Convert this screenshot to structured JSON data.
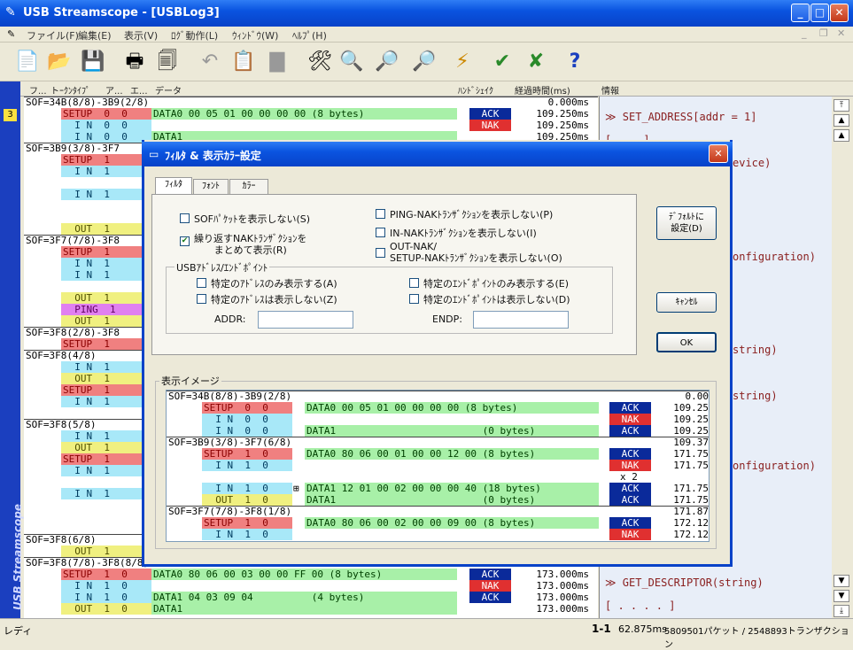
{
  "app": {
    "title": "USB Streamscope - [USBLog3]"
  },
  "menu": {
    "items": [
      "ファイル(F)",
      "編集(E)",
      "表示(V)",
      "ﾛｸﾞ動作(L)",
      "ｳｨﾝﾄﾞｳ(W)",
      "ﾍﾙﾌﾟ(H)"
    ]
  },
  "columns": {
    "c1": "フ...",
    "c2": "トｰｸﾝﾀｲﾌﾟ",
    "c3": "ア...",
    "c4": "エ...",
    "c5": "データ",
    "c6": "ﾊﾝﾄﾞｼｪｲｸ",
    "c7": "経過時間(ms)",
    "c8": "情報"
  },
  "sidebar": {
    "label": "USB Streamscope",
    "marker": "3"
  },
  "list": {
    "rows": [
      {
        "sof": "SOF=34B(8/8)-3B9(2/8)",
        "t": "0.000ms"
      },
      {
        "tok": "SETUP  0  0",
        "data": "DATA0 00 05 01 00 00 00 00 (8 bytes)",
        "hs": "ACK",
        "t": "109.250ms"
      },
      {
        "tok": "  I N  0  0",
        "hs": "NAK",
        "t": "109.250ms"
      },
      {
        "tok": "  I N  0  0",
        "data": "DATA1",
        "t": "109.250ms"
      },
      {
        "sof": "SOF=3B9(3/8)-3F7"
      },
      {
        "tok": "SETUP  1",
        "cls": "setup"
      },
      {
        "tok": "  I N  1",
        "cls": "in"
      },
      {
        "tok": "  I N  1",
        "cls": "in"
      },
      {
        "tok": "  OUT  1",
        "cls": "out"
      },
      {
        "sof": "SOF=3F7(7/8)-3F8"
      },
      {
        "tok": "SETUP  1",
        "cls": "setup"
      },
      {
        "tok": "  I N  1",
        "cls": "in"
      },
      {
        "tok": "  I N  1",
        "cls": "in"
      },
      {
        "tok": "  OUT  1",
        "cls": "out"
      },
      {
        "tok": "  PING  1",
        "cls": "ping"
      },
      {
        "tok": "  OUT  1",
        "cls": "out"
      },
      {
        "sof": "SOF=3F8(2/8)-3F8"
      },
      {
        "tok": "SETUP  1",
        "cls": "setup"
      },
      {
        "sof": "SOF=3F8(4/8)"
      },
      {
        "tok": "  I N  1",
        "cls": "in"
      },
      {
        "tok": "  OUT  1",
        "cls": "out"
      },
      {
        "tok": "SETUP  1",
        "cls": "setup"
      },
      {
        "tok": "  I N  1",
        "cls": "in"
      },
      {
        "sof": "SOF=3F8(5/8)"
      },
      {
        "tok": "  I N  1",
        "cls": "in"
      },
      {
        "tok": "  OUT  1",
        "cls": "out"
      },
      {
        "tok": "SETUP  1",
        "cls": "setup"
      },
      {
        "tok": "  I N  1",
        "cls": "in"
      },
      {
        "tok": "  I N  1",
        "cls": "in"
      },
      {
        "sof": "SOF=3F8(6/8)"
      },
      {
        "tok": "  OUT  1",
        "cls": "out"
      },
      {
        "sof": "SOF=3F8(7/8)-3F8(8/8)",
        "t": "172.875ms"
      },
      {
        "tok": "SETUP  1  0",
        "data": "DATA0 80 06 00 03 00 00 FF 00 (8 bytes)",
        "hs": "ACK",
        "t": "173.000ms"
      },
      {
        "tok": "  I N  1  0",
        "hs": "NAK",
        "t": "173.000ms"
      },
      {
        "tok": "  I N  1  0",
        "data": "DATA1 04 03 09 04          (4 bytes)",
        "hs": "ACK",
        "t": "173.000ms"
      },
      {
        "tok": "  OUT  1  0",
        "data": "DATA1",
        "t": "173.000ms"
      }
    ]
  },
  "info": {
    "i1": "≫ SET_ADDRESS[addr = 1]",
    "i2": "[ . . ]",
    "i3": "evice)",
    "i4": "onfiguration)",
    "i5": "string)",
    "i6": "string)",
    "i7": "onfiguration)",
    "i8": "≫ GET_DESCRIPTOR(string)",
    "i9": "[ . . . . ]"
  },
  "status": {
    "left": "レディ",
    "range": "1-1",
    "elapsed": "62.875ms",
    "counts": "5809501パケット / 2548893トランザクション"
  },
  "dialog": {
    "title": "ﾌｨﾙﾀ & 表示ｶﾗｰ設定",
    "tabs": [
      "ﾌｨﾙﾀ",
      "ﾌｫﾝﾄ",
      "ｶﾗｰ"
    ],
    "opt_sof": "SOFﾊﾟｹｯﾄを表示しない(S)",
    "opt_nak_group": "繰り返すNAKﾄﾗﾝｻﾞｸｼｮﾝを\nまとめて表示(R)",
    "opt_ping": "PING-NAKﾄﾗﾝｻﾞｸｼｮﾝを表示しない(P)",
    "opt_in_nak": "IN-NAKﾄﾗﾝｻﾞｸｼｮﾝを表示しない(I)",
    "opt_out_nak": "OUT-NAK/\nSETUP-NAKﾄﾗﾝｻﾞｸｼｮﾝを表示しない(O)",
    "group_title": "USBｱﾄﾞﾚｽ/ｴﾝﾄﾞﾎﾟｲﾝﾄ",
    "opt_addr_only": "特定のｱﾄﾞﾚｽのみ表示する(A)",
    "opt_addr_hide": "特定のｱﾄﾞﾚｽは表示しない(Z)",
    "opt_ep_only": "特定のｴﾝﾄﾞﾎﾟｲﾝﾄのみ表示する(E)",
    "opt_ep_hide": "特定のｴﾝﾄﾞﾎﾟｲﾝﾄは表示しない(D)",
    "addr_label": "ADDR:",
    "endp_label": "ENDP:",
    "btn_default": "ﾃﾞﾌｫﾙﾄに\n設定(D)",
    "btn_cancel": "ｷｬﾝｾﾙ",
    "btn_ok": "OK",
    "preview_title": "表示イメージ",
    "checked_nak_group": true
  },
  "preview": {
    "rows": [
      {
        "sof": "SOF=34B(8/8)-3B9(2/8)",
        "t": "0.00"
      },
      {
        "tok": "SETUP  0  0",
        "cls": "setup",
        "data": "DATA0 00 05 01 00 00 00 00 (8 bytes)",
        "hs": "ACK",
        "t": "109.25"
      },
      {
        "tok": "  I N  0  0",
        "cls": "in",
        "hs": "NAK",
        "t": "109.25"
      },
      {
        "tok": "  I N  0  0",
        "cls": "in",
        "data": "DATA1                         (0 bytes)",
        "hs": "ACK",
        "t": "109.25"
      },
      {
        "sof": "SOF=3B9(3/8)-3F7(6/8)",
        "t": "109.37"
      },
      {
        "tok": "SETUP  1  0",
        "cls": "setup",
        "data": "DATA0 80 06 00 01 00 00 12 00 (8 bytes)",
        "hs": "ACK",
        "t": "171.75"
      },
      {
        "tok": "  I N  1  0",
        "cls": "in",
        "hs": "NAK",
        "t": "171.75"
      },
      {
        "x2": "x 2"
      },
      {
        "tok": "  I N  1  0",
        "cls": "in",
        "data": "DATA1 12 01 00 02 00 00 00 40 (18 bytes)",
        "plus": true,
        "hs": "ACK",
        "t": "171.75"
      },
      {
        "tok": "  OUT  1  0",
        "cls": "out",
        "data": "DATA1                         (0 bytes)",
        "hs": "ACK",
        "t": "171.75"
      },
      {
        "sof": "SOF=3F7(7/8)-3F8(1/8)",
        "t": "171.87"
      },
      {
        "tok": "SETUP  1  0",
        "cls": "setup",
        "data": "DATA0 80 06 00 02 00 00 09 00 (8 bytes)",
        "hs": "ACK",
        "t": "172.12"
      },
      {
        "tok": "  I N  1  0",
        "cls": "in",
        "hs": "NAK",
        "t": "172.12"
      }
    ]
  }
}
